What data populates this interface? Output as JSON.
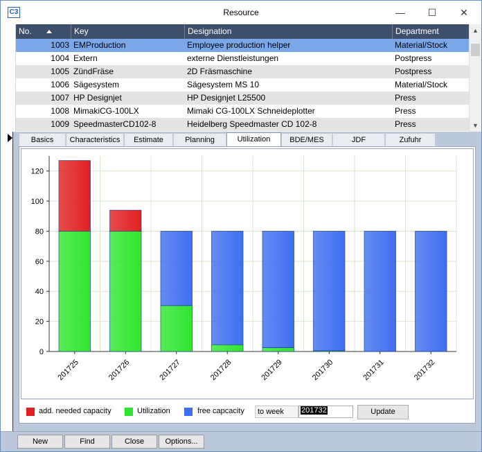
{
  "window": {
    "title": "Resource",
    "icon": "app-logo-icon",
    "icon_text": "C3",
    "controls": [
      "minimize-icon",
      "maximize-icon",
      "close-icon"
    ]
  },
  "grid": {
    "columns": [
      {
        "label": "No.",
        "sorted": "ascending"
      },
      {
        "label": "Key"
      },
      {
        "label": "Designation"
      },
      {
        "label": "Department"
      }
    ],
    "rows": [
      {
        "no": "1003",
        "key": "EMProduction",
        "designation": "Employee production helper",
        "department": "Material/Stock",
        "selected": true
      },
      {
        "no": "1004",
        "key": "Extern",
        "designation": "externe Dienstleistungen",
        "department": "Postpress"
      },
      {
        "no": "1005",
        "key": "ZündFräse",
        "designation": "2D Fräsmaschine",
        "department": "Postpress"
      },
      {
        "no": "1006",
        "key": "Sägesystem",
        "designation": "Sägesystem MS 10",
        "department": "Material/Stock"
      },
      {
        "no": "1007",
        "key": "HP Designjet",
        "designation": "HP Designjet L25500",
        "department": "Press"
      },
      {
        "no": "1008",
        "key": "MimakiCG-100LX",
        "designation": "Mimaki CG-100LX Schneideplotter",
        "department": "Press"
      },
      {
        "no": "1009",
        "key": "SpeedmasterCD102-8",
        "designation": "Heidelberg Speedmaster CD 102-8",
        "department": "Press"
      }
    ]
  },
  "tabs": [
    {
      "label": "Basics"
    },
    {
      "label": "Characteristics"
    },
    {
      "label": "Estimate"
    },
    {
      "label": "Planning"
    },
    {
      "label": "Utilization",
      "active": true
    },
    {
      "label": "BDE/MES"
    },
    {
      "label": "JDF"
    },
    {
      "label": "Zufuhr"
    }
  ],
  "colors": {
    "utilization": "#2fe62f",
    "add_needed": "#e02020",
    "free": "#3f6ff0",
    "selected_row": "#7aa7e8",
    "header": "#3d4f6b"
  },
  "chart_data": {
    "type": "bar",
    "stacked": true,
    "categories": [
      "201725",
      "201726",
      "201727",
      "201728",
      "201729",
      "201730",
      "201731",
      "201732"
    ],
    "series": [
      {
        "name": "Utilization",
        "color": "#2fe62f",
        "values": [
          80,
          80,
          30.5,
          4.5,
          2.5,
          0.5,
          0,
          0
        ]
      },
      {
        "name": "free capcacity",
        "color": "#3f6ff0",
        "values": [
          0,
          0,
          49.5,
          75.5,
          77.5,
          79.5,
          80,
          80
        ]
      },
      {
        "name": "add. needed capacity",
        "color": "#e02020",
        "values": [
          47,
          14,
          0,
          0,
          0,
          0,
          0,
          0
        ]
      }
    ],
    "ylim": [
      0,
      130
    ],
    "yticks": [
      0,
      20,
      40,
      60,
      80,
      100,
      120
    ],
    "grid": true,
    "legend": "bottom",
    "title": "",
    "xlabel": "",
    "ylabel": ""
  },
  "legend": {
    "items": [
      {
        "label": "add. needed capacity",
        "color": "#e02020"
      },
      {
        "label": "Utilization",
        "color": "#2fe62f"
      },
      {
        "label": "free capcacity",
        "color": "#3f6ff0"
      }
    ],
    "to_week_label": "to week",
    "week_value": "201732",
    "update_label": "Update"
  },
  "footer": {
    "new_label": "New",
    "find_label": "Find",
    "close_label": "Close",
    "options_label": "Options..."
  }
}
